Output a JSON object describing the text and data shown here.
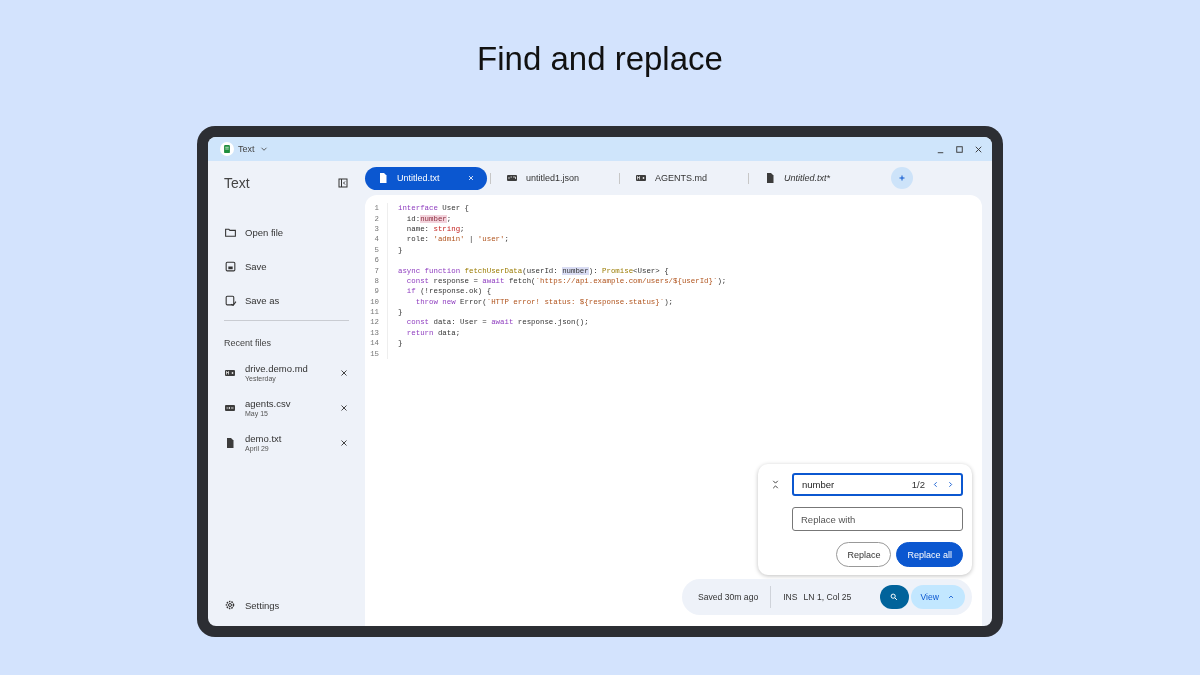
{
  "heading": "Find and replace",
  "window": {
    "app_name": "Text"
  },
  "sidebar": {
    "title": "Text",
    "actions": [
      {
        "label": "Open file",
        "kind": "open"
      },
      {
        "label": "Save",
        "kind": "save"
      },
      {
        "label": "Save as",
        "kind": "saveas"
      }
    ],
    "recent_title": "Recent files",
    "recent_files": [
      {
        "name": "drive.demo.md",
        "date": "Yesterday",
        "kind": "markdown"
      },
      {
        "name": "agents.csv",
        "date": "May 15",
        "kind": "csv"
      },
      {
        "name": "demo.txt",
        "date": "April 29",
        "kind": "text"
      }
    ],
    "settings": "Settings"
  },
  "tabs": [
    {
      "label": "Untitled.txt",
      "kind": "text",
      "selected": true,
      "unsaved": false
    },
    {
      "label": "untitled1.json",
      "kind": "json",
      "selected": false,
      "unsaved": false
    },
    {
      "label": "AGENTS.md",
      "kind": "markdown",
      "selected": false,
      "unsaved": false
    },
    {
      "label": "Untitled.txt*",
      "kind": "text",
      "selected": false,
      "unsaved": true
    }
  ],
  "editor": {
    "lines": [
      {
        "n": "1",
        "tokens": [
          {
            "text": "interface",
            "kind": "kw"
          },
          {
            "text": " User {",
            "kind": "plain"
          }
        ]
      },
      {
        "n": "2",
        "tokens": [
          {
            "text": "  id:",
            "kind": "plain"
          },
          {
            "text": "number",
            "kind": "hit-current"
          },
          {
            "text": ";",
            "kind": "plain"
          }
        ]
      },
      {
        "n": "3",
        "tokens": [
          {
            "text": "  name: ",
            "kind": "plain"
          },
          {
            "text": "string",
            "kind": "type"
          },
          {
            "text": ";",
            "kind": "plain"
          }
        ]
      },
      {
        "n": "4",
        "tokens": [
          {
            "text": "  role: ",
            "kind": "plain"
          },
          {
            "text": "'admin'",
            "kind": "str"
          },
          {
            "text": " | ",
            "kind": "plain"
          },
          {
            "text": "'user'",
            "kind": "str"
          },
          {
            "text": ";",
            "kind": "plain"
          }
        ]
      },
      {
        "n": "5",
        "tokens": [
          {
            "text": "}",
            "kind": "plain"
          }
        ]
      },
      {
        "n": "6"
      },
      {
        "n": "7",
        "tokens": [
          {
            "text": "async function ",
            "kind": "kw"
          },
          {
            "text": "fetchUserData",
            "kind": "fn"
          },
          {
            "text": "(userId: ",
            "kind": "plain"
          },
          {
            "text": "number",
            "kind": "hit"
          },
          {
            "text": "): ",
            "kind": "plain"
          },
          {
            "text": "Promise",
            "kind": "fn"
          },
          {
            "text": "<User> {",
            "kind": "plain"
          }
        ]
      },
      {
        "n": "8",
        "tokens": [
          {
            "text": "  const ",
            "kind": "kw"
          },
          {
            "text": "response = ",
            "kind": "plain"
          },
          {
            "text": "await ",
            "kind": "kw"
          },
          {
            "text": "fetch(",
            "kind": "plain"
          },
          {
            "text": "`https://api.example.com/users/${userId}`",
            "kind": "str"
          },
          {
            "text": ");",
            "kind": "plain"
          }
        ]
      },
      {
        "n": "9",
        "tokens": [
          {
            "text": "  if ",
            "kind": "kw"
          },
          {
            "text": "(!response.ok) {",
            "kind": "plain"
          }
        ]
      },
      {
        "n": "10",
        "tokens": [
          {
            "text": "    throw new ",
            "kind": "kw"
          },
          {
            "text": "Error(",
            "kind": "plain"
          },
          {
            "text": "`HTTP error! status: ${response.status}`",
            "kind": "str"
          },
          {
            "text": ");",
            "kind": "plain"
          }
        ]
      },
      {
        "n": "11",
        "tokens": [
          {
            "text": "}",
            "kind": "plain"
          }
        ]
      },
      {
        "n": "12",
        "tokens": [
          {
            "text": "  const ",
            "kind": "kw"
          },
          {
            "text": "data: User = ",
            "kind": "plain"
          },
          {
            "text": "await ",
            "kind": "kw"
          },
          {
            "text": "response.json();",
            "kind": "plain"
          }
        ]
      },
      {
        "n": "13",
        "tokens": [
          {
            "text": "  return ",
            "kind": "kw"
          },
          {
            "text": "data;",
            "kind": "plain"
          }
        ]
      },
      {
        "n": "14",
        "tokens": [
          {
            "text": "}",
            "kind": "plain"
          }
        ]
      },
      {
        "n": "15"
      }
    ]
  },
  "find": {
    "query": "number",
    "count": "1/2",
    "replace_placeholder": "Replace with",
    "buttons": [
      {
        "label": "Replace",
        "kind": "outline"
      },
      {
        "label": "Replace all",
        "kind": "filled"
      }
    ]
  },
  "status_bar": {
    "saved": "Saved 30m ago",
    "mode": "INS",
    "position": "LN 1, Col 25",
    "view": "View"
  }
}
